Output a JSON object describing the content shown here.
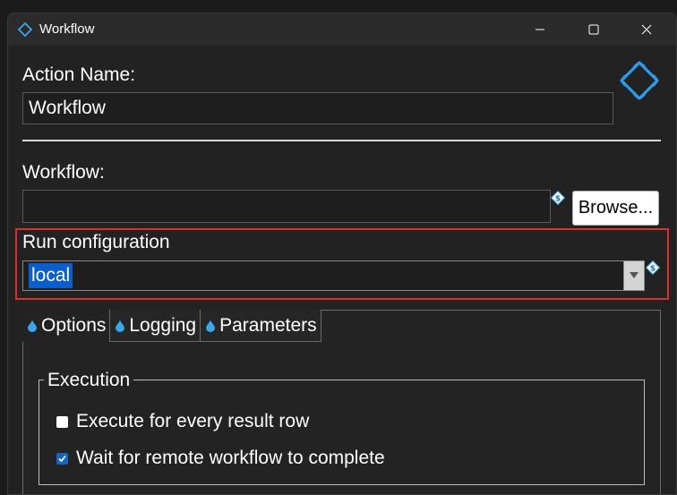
{
  "window": {
    "title": "Workflow",
    "controls": {
      "minimize": "minimize",
      "maximize": "maximize",
      "close": "close"
    }
  },
  "action_name": {
    "label": "Action Name:",
    "value": "Workflow"
  },
  "workflow": {
    "label": "Workflow:",
    "value": "",
    "browse_label": "Browse..."
  },
  "run_configuration": {
    "label": "Run configuration",
    "selected": "local"
  },
  "tabs": [
    {
      "label": "Options",
      "active": true
    },
    {
      "label": "Logging",
      "active": false
    },
    {
      "label": "Parameters",
      "active": false
    }
  ],
  "execution": {
    "group_title": "Execution",
    "options": [
      {
        "label": "Execute for every result row",
        "checked": false
      },
      {
        "label": "Wait for remote workflow to complete",
        "checked": true
      }
    ]
  },
  "colors": {
    "accent": "#2e9be8",
    "highlight_border": "#d9302c",
    "selection": "#0a5fcc"
  },
  "icons": {
    "title": "workflow-diamond-icon",
    "header": "workflow-arrows-icon",
    "variable": "variable-dollar-icon",
    "tab": "droplet-icon"
  }
}
